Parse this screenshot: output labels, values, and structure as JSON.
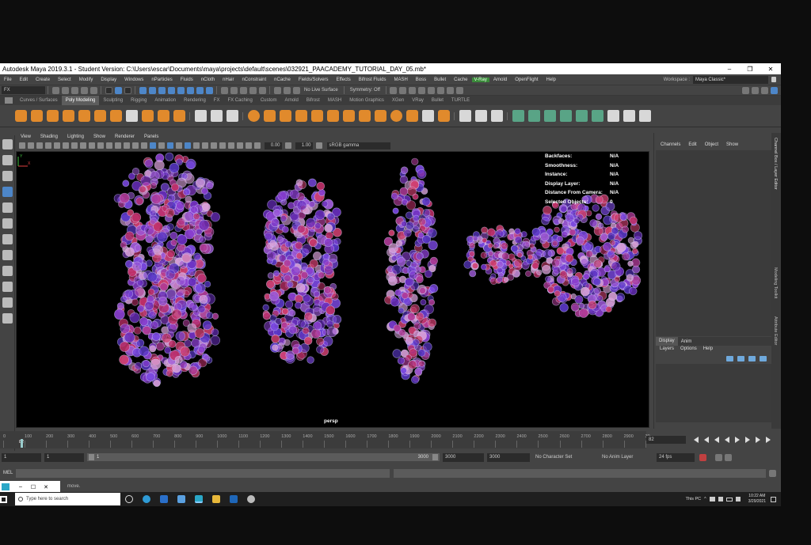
{
  "window": {
    "title": "Autodesk Maya 2019.3.1 - Student Version: C:\\Users\\escar\\Documents\\maya\\projects\\default\\scenes\\032921_PAACADEMY_TUTORIAL_DAY_05.mb*",
    "minimize": "–",
    "maximize": "❐",
    "close": "✕"
  },
  "menubar": {
    "items": [
      "File",
      "Edit",
      "Create",
      "Select",
      "Modify",
      "Display",
      "Windows",
      "nParticles",
      "Fluids",
      "nCloth",
      "nHair",
      "nConstraint",
      "nCache",
      "Fields/Solvers",
      "Effects",
      "Bifrost Fluids",
      "MASH",
      "Boss",
      "Bullet",
      "Cache",
      "V-Ray",
      "Arnold",
      "OpenFlight",
      "Help"
    ],
    "highlighted": "V-Ray",
    "workspace_label": "Workspace :",
    "workspace_value": "Maya Classic*"
  },
  "statusline": {
    "mode_dropdown": "FX",
    "live_surface": "No Live Surface",
    "symmetry": "Symmetry: Off"
  },
  "shelf": {
    "tabs": [
      "Curves / Surfaces",
      "Poly Modeling",
      "Sculpting",
      "Rigging",
      "Animation",
      "Rendering",
      "FX",
      "FX Caching",
      "Custom",
      "Arnold",
      "Bifrost",
      "MASH",
      "Motion Graphics",
      "XGen",
      "VRay",
      "Bullet",
      "TURTLE"
    ],
    "active_tab": "Poly Modeling"
  },
  "viewport": {
    "menu": [
      "View",
      "Shading",
      "Lighting",
      "Show",
      "Renderer",
      "Panels"
    ],
    "exposure": "0.00",
    "gamma": "1.00",
    "color_space": "sRGB gamma",
    "hud": [
      {
        "label": "Backfaces:",
        "value": "N/A"
      },
      {
        "label": "Smoothness:",
        "value": "N/A"
      },
      {
        "label": "Instance:",
        "value": "N/A"
      },
      {
        "label": "Display Layer:",
        "value": "N/A"
      },
      {
        "label": "Distance From Camera:",
        "value": "N/A"
      },
      {
        "label": "Selected Objects:",
        "value": "0"
      }
    ],
    "camera": "persp",
    "axis_x": "X",
    "axis_y": "Y"
  },
  "channel_box": {
    "menu": [
      "Channels",
      "Edit",
      "Object",
      "Show"
    ],
    "side_tabs": [
      "Channel Box / Layer Editor",
      "Modeling Toolkit",
      "Attribute Editor"
    ],
    "layer_tabs": [
      "Display",
      "Anim"
    ],
    "layer_menu": [
      "Layers",
      "Options",
      "Help"
    ]
  },
  "timeline": {
    "ticks": [
      "0",
      "100",
      "200",
      "300",
      "400",
      "500",
      "600",
      "700",
      "800",
      "900",
      "1000",
      "1100",
      "1200",
      "1300",
      "1400",
      "1500",
      "1600",
      "1700",
      "1800",
      "1900",
      "2000",
      "2100",
      "2200",
      "2300",
      "2400",
      "2500",
      "2600",
      "2700",
      "2800",
      "2900",
      "30"
    ],
    "current_marker": "82",
    "current_frame": "82"
  },
  "range": {
    "start": "1",
    "playback_start": "1",
    "slider_start": "1",
    "slider_end": "3000",
    "playback_end": "3000",
    "end": "3000",
    "character_set": "No Character Set",
    "anim_layer": "No Anim Layer",
    "fps": "24 fps"
  },
  "command_line": {
    "label": "MEL",
    "help_text": "move."
  },
  "taskbar": {
    "search_placeholder": "Type here to search",
    "this_pc": "This PC",
    "time": "10:22 AM",
    "date": "3/29/2021"
  }
}
